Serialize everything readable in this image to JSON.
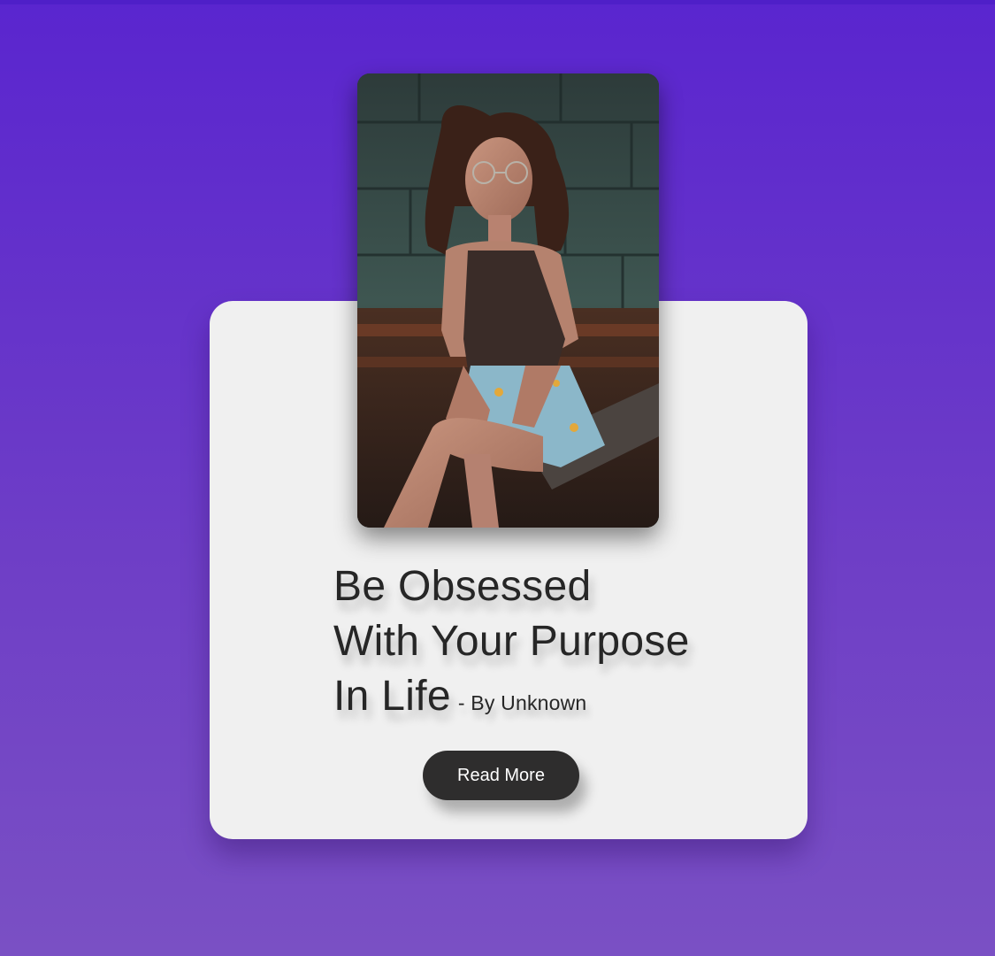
{
  "quote": {
    "lines": [
      "Be Obsessed",
      "With Your Purpose",
      "In Life"
    ],
    "author": "- By Unknown"
  },
  "button": {
    "label": "Read More"
  },
  "photo": {
    "alt": "Woman with glasses sitting on wooden planks in front of a green block wall"
  },
  "colors": {
    "background_top": "#5a25cf",
    "background_bottom": "#7a50c4",
    "card": "#f0f0f0",
    "button": "#2e2d2d",
    "text": "#262626"
  }
}
